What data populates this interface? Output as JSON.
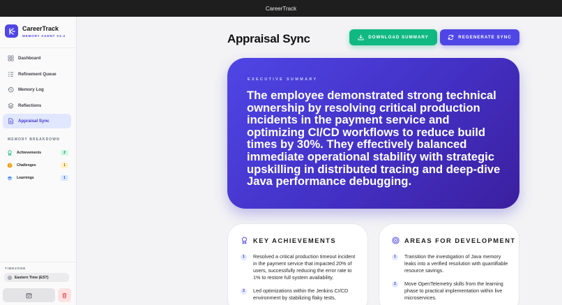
{
  "window": {
    "title": "CareerTrack"
  },
  "brand": {
    "name": "CareerTrack",
    "subtitle": "MEMORY AGENT V4.2"
  },
  "nav": {
    "items": [
      {
        "label": "Dashboard",
        "icon": "dashboard-icon"
      },
      {
        "label": "Refinement Queue",
        "icon": "queue-icon"
      },
      {
        "label": "Memory Log",
        "icon": "history-icon"
      },
      {
        "label": "Reflections",
        "icon": "layers-icon"
      },
      {
        "label": "Appraisal Sync",
        "icon": "document-icon",
        "active": true
      }
    ]
  },
  "memory_breakdown": {
    "title": "MEMORY BREAKDOWN",
    "rows": [
      {
        "label": "Achievements",
        "count": "2",
        "color": "#10b981"
      },
      {
        "label": "Challenges",
        "count": "1",
        "color": "#f59e0b"
      },
      {
        "label": "Learnings",
        "count": "1",
        "color": "#3b82f6"
      }
    ]
  },
  "timezone": {
    "label": "TIMEZONE",
    "value": "Eastern Time (EST)"
  },
  "header": {
    "title": "Appraisal Sync",
    "download_label": "DOWNLOAD SUMMARY",
    "regenerate_label": "REGENERATE SYNC"
  },
  "executive_summary": {
    "label": "EXECUTIVE SUMMARY",
    "text": "The employee demonstrated strong technical ownership by resolving critical production incidents in the payment service and optimizing CI/CD workflows to reduce build times by 30%. They effectively balanced immediate operational stability with strategic upskilling in distributed tracing and deep-dive Java performance debugging."
  },
  "achievements": {
    "title": "KEY ACHIEVEMENTS",
    "items": [
      {
        "num": "1",
        "text": "Resolved a critical production timeout incident in the payment service that impacted 20% of users, successfully reducing the error rate to 1% to restore full system availability."
      },
      {
        "num": "2",
        "text": "Led optimizations within the Jenkins CI/CD environment by stabilizing flaky tests,"
      }
    ]
  },
  "development": {
    "title": "AREAS FOR DEVELOPMENT",
    "items": [
      {
        "num": "1",
        "text": "Transition the investigation of Java memory leaks into a verified resolution with quantifiable resource savings."
      },
      {
        "num": "2",
        "text": "Move OpenTelemetry skills from the learning phase to practical implementation within live microservices."
      }
    ]
  },
  "colors": {
    "accent": "#4f46e5",
    "success": "#10b981",
    "danger": "#ef4444"
  }
}
